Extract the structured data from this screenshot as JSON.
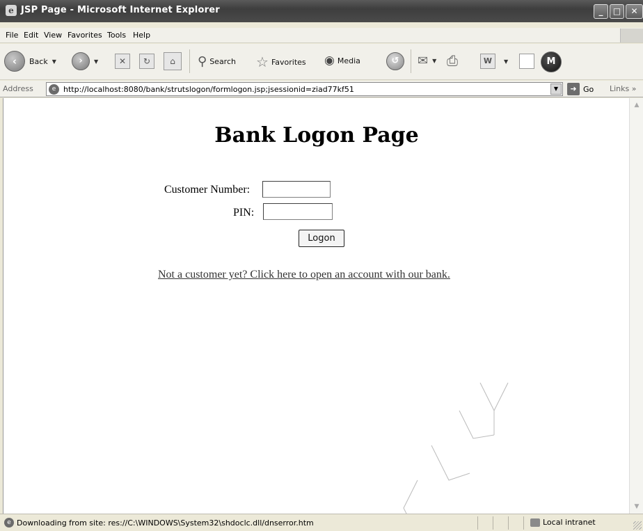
{
  "window": {
    "title": "JSP Page - Microsoft Internet Explorer",
    "app_icon": "e",
    "controls": {
      "minimize": "_",
      "maximize": "□",
      "close": "✕"
    }
  },
  "menu": {
    "items": [
      "File",
      "Edit",
      "View",
      "Favorites",
      "Tools",
      "Help"
    ]
  },
  "toolbar": {
    "back_label": "Back",
    "search_label": "Search",
    "favorites_label": "Favorites",
    "media_label": "Media"
  },
  "address": {
    "label": "Address",
    "url": "http://localhost:8080/bank/strutslogon/formlogon.jsp;jsessionid=ziad77kf51",
    "go_label": "Go",
    "links_label": "Links »"
  },
  "page": {
    "heading": "Bank Logon Page",
    "customer_number_label": "Customer Number:",
    "customer_number_value": "",
    "pin_label": "PIN:",
    "pin_value": "",
    "logon_button": "Logon",
    "signup_link": "Not a customer yet? Click here to open an account with our bank."
  },
  "status": {
    "text": "Downloading from site: res://C:\\WINDOWS\\System32\\shdoclc.dll/dnserror.htm",
    "zone": "Local intranet"
  },
  "watermark": {
    "text": "AMFLY"
  },
  "colors": {
    "titlebar": "#4a4a4a",
    "chrome": "#f1f0ea",
    "content_bg": "#ffffff",
    "link": "#333333"
  }
}
